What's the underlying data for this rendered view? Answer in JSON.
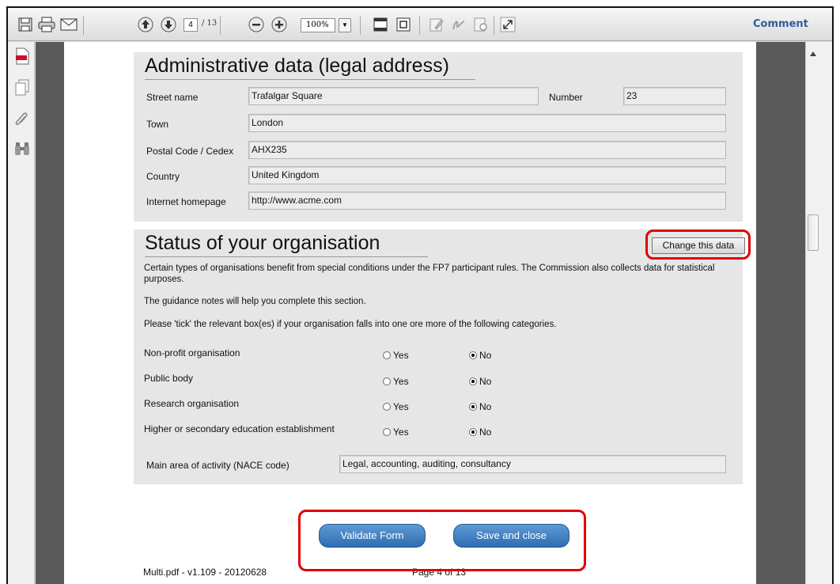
{
  "toolbar": {
    "page_current": "4",
    "page_total": "/ 13",
    "zoom": "100%",
    "comment": "Comment"
  },
  "admin": {
    "title": "Administrative data (legal address)",
    "street_label": "Street name",
    "street_value": "Trafalgar Square",
    "number_label": "Number",
    "number_value": "23",
    "town_label": "Town",
    "town_value": "London",
    "postal_label": "Postal Code / Cedex",
    "postal_value": "AHX235",
    "country_label": "Country",
    "country_value": "United Kingdom",
    "homepage_label": "Internet homepage",
    "homepage_value": "http://www.acme.com"
  },
  "status": {
    "title": "Status of your organisation",
    "change_button": "Change this data",
    "para1": "Certain types of organisations benefit from special conditions under the FP7 participant rules. The Commission also collects data for statistical purposes.",
    "para2": "The guidance notes will help you complete this section.",
    "para3": "Please 'tick' the relevant box(es) if your organisation falls into one ore more of the following categories.",
    "yes_label": "Yes",
    "no_label": "No",
    "rows": [
      {
        "label": "Non-profit organisation",
        "selected": "No"
      },
      {
        "label": "Public body",
        "selected": "No"
      },
      {
        "label": "Research organisation",
        "selected": "No"
      },
      {
        "label": "Higher or secondary education establishment",
        "selected": "No"
      }
    ],
    "nace_label": "Main area of activity (NACE code)",
    "nace_value": "Legal, accounting, auditing, consultancy"
  },
  "actions": {
    "validate": "Validate Form",
    "save_close": "Save and close"
  },
  "footer": {
    "file": "Multi.pdf - v1.109 - 20120628",
    "page": "Page 4 of 13"
  },
  "colors": {
    "highlight": "#e20000",
    "button": "#3a7cc0",
    "comment": "#2e5d9a"
  }
}
